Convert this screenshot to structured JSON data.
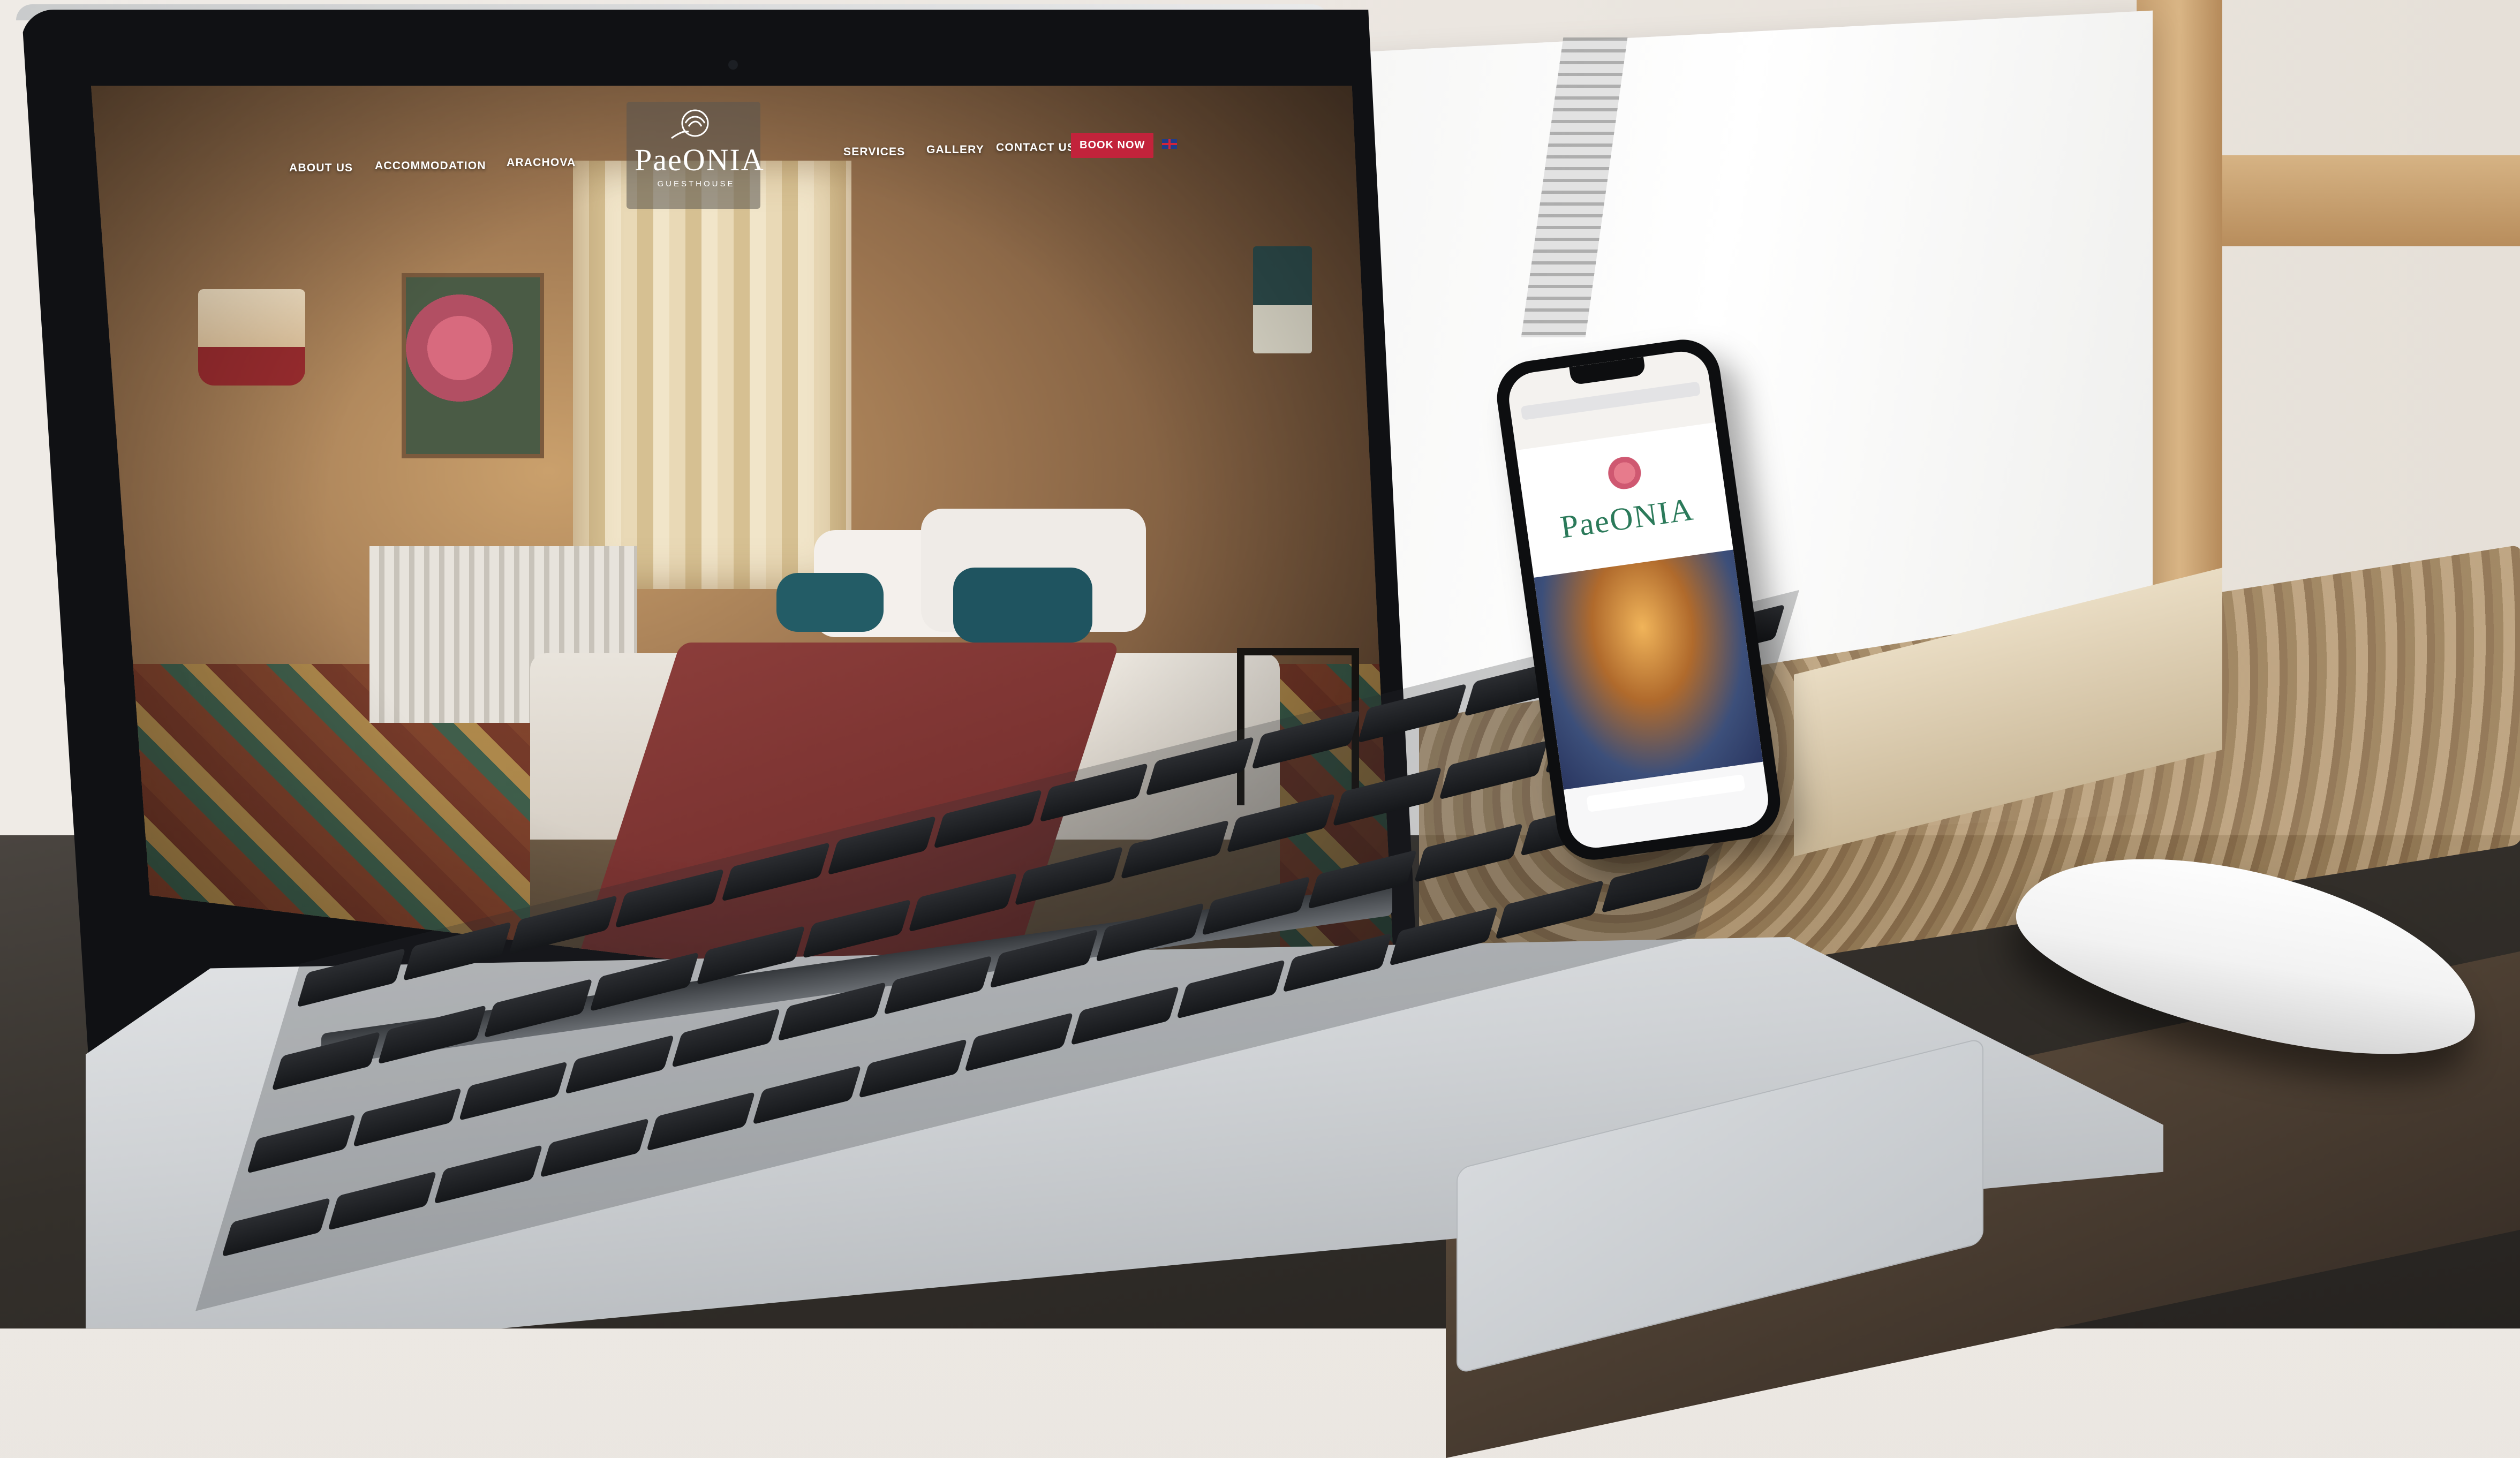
{
  "website": {
    "nav_left": [
      "ABOUT US",
      "ACCOMMODATION",
      "ARACHOVA"
    ],
    "logo": {
      "name": "PaeONIA",
      "subtitle": "GUESTHOUSE"
    },
    "nav_right": [
      "SERVICES",
      "GALLERY",
      "CONTACT US"
    ],
    "book_button": "BOOK NOW",
    "language_icon": "uk-flag-icon"
  },
  "phone": {
    "logo_word": "PaeONIA"
  },
  "colors": {
    "book_button": "#c2233b",
    "phone_logo": "#2b7a5a"
  }
}
